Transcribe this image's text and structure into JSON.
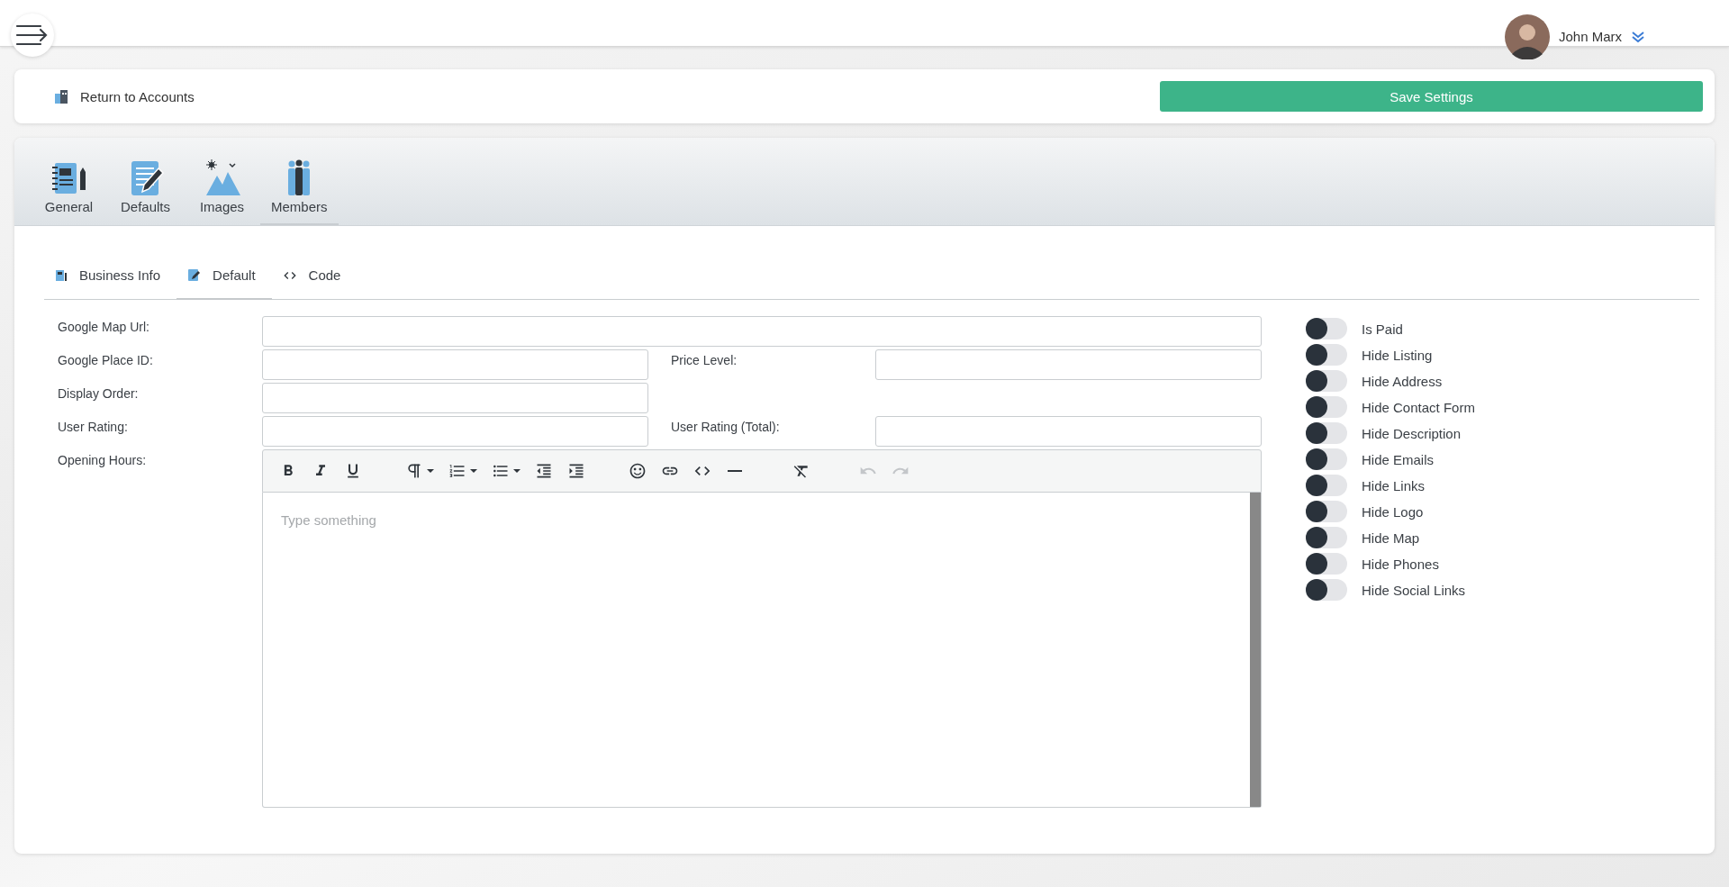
{
  "header": {
    "user_name": "John Marx"
  },
  "top_bar": {
    "back_link": "Return to Accounts",
    "save_button": "Save Settings"
  },
  "main_tabs": [
    {
      "label": "General",
      "selected": false
    },
    {
      "label": "Defaults",
      "selected": false
    },
    {
      "label": "Images",
      "selected": false
    },
    {
      "label": "Members",
      "selected": true
    }
  ],
  "sub_tabs": [
    {
      "label": "Business Info",
      "selected": false
    },
    {
      "label": "Default",
      "selected": true
    },
    {
      "label": "Code",
      "selected": false
    }
  ],
  "form_rows": [
    {
      "kind": "wide",
      "fields": [
        {
          "label": "Google Map Url:"
        }
      ]
    },
    {
      "kind": "pair",
      "fields": [
        {
          "label": "Google Place ID:"
        },
        {
          "label": "Price Level:"
        }
      ]
    },
    {
      "kind": "pair",
      "fields": [
        {
          "label": "Display Order:"
        }
      ]
    },
    {
      "kind": "pair",
      "fields": [
        {
          "label": "User Rating:"
        },
        {
          "label": "User Rating (Total):"
        }
      ]
    }
  ],
  "opening_hours": {
    "label": "Opening Hours:",
    "placeholder": "Type something",
    "toolbar": [
      {
        "kind": "bold",
        "disabled": false
      },
      {
        "kind": "italic",
        "disabled": false
      },
      {
        "kind": "underline",
        "disabled": false
      },
      {
        "kind": "paragraph",
        "disabled": false
      },
      {
        "kind": "ordered-list",
        "disabled": false
      },
      {
        "kind": "bullet-list",
        "disabled": false
      },
      {
        "kind": "outdent",
        "disabled": false
      },
      {
        "kind": "indent",
        "disabled": false
      },
      {
        "kind": "emoji",
        "disabled": false
      },
      {
        "kind": "link",
        "disabled": false
      },
      {
        "kind": "code",
        "disabled": false
      },
      {
        "kind": "horizontal-rule",
        "disabled": false
      },
      {
        "kind": "clear-format",
        "disabled": false
      },
      {
        "kind": "undo",
        "disabled": true
      },
      {
        "kind": "redo",
        "disabled": true
      }
    ]
  },
  "toggles": [
    {
      "label": "Is Paid",
      "on": false
    },
    {
      "label": "Hide Listing",
      "on": false
    },
    {
      "label": "Hide Address",
      "on": false
    },
    {
      "label": "Hide Contact Form",
      "on": false
    },
    {
      "label": "Hide Description",
      "on": false
    },
    {
      "label": "Hide Emails",
      "on": false
    },
    {
      "label": "Hide Links",
      "on": false
    },
    {
      "label": "Hide Logo",
      "on": false
    },
    {
      "label": "Hide Map",
      "on": false
    },
    {
      "label": "Hide Phones",
      "on": false
    },
    {
      "label": "Hide Social Links",
      "on": false
    }
  ]
}
